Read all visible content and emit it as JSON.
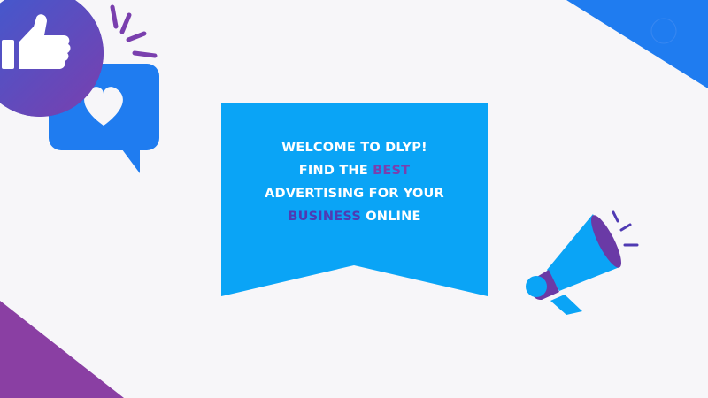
{
  "banner": {
    "line1": "WELCOME TO DLYP!",
    "line2_a": "FIND THE ",
    "line2_highlight": "BEST",
    "line3": "ADVERTISING FOR YOUR",
    "line4_highlight": "BUSINESS",
    "line4_b": " ONLINE"
  },
  "icons": [
    "thumbs-up-icon",
    "heart-speech-bubble-icon",
    "megaphone-icon"
  ],
  "colors": {
    "background": "#f7f6f9",
    "banner": "#0aa4f6",
    "accent_blue": "#1f7cf0",
    "accent_purple": "#7a3fae",
    "accent_indigo": "#4f3ab3"
  }
}
